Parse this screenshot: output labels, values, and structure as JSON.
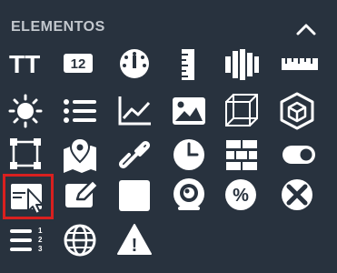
{
  "panel": {
    "title": "ELEMENTOS",
    "collapse_icon": "chevron-up-icon"
  },
  "colors": {
    "background": "#28323e",
    "icon": "#ffffff",
    "title": "#c3c8ce",
    "selection": "#d9201f"
  },
  "elements": [
    {
      "name": "text-size-icon",
      "glyph_text": "TT"
    },
    {
      "name": "number-icon",
      "glyph_text": "12"
    },
    {
      "name": "gauge-icon"
    },
    {
      "name": "vertical-ruler-icon"
    },
    {
      "name": "bar-columns-icon"
    },
    {
      "name": "horizontal-ruler-icon"
    },
    {
      "name": "sun-icon"
    },
    {
      "name": "list-icon"
    },
    {
      "name": "line-chart-icon"
    },
    {
      "name": "image-icon"
    },
    {
      "name": "cube-outline-icon"
    },
    {
      "name": "3d-box-icon"
    },
    {
      "name": "selection-frame-icon"
    },
    {
      "name": "map-pin-icon"
    },
    {
      "name": "link-icon"
    },
    {
      "name": "clock-icon"
    },
    {
      "name": "stack-icon"
    },
    {
      "name": "toggle-icon"
    },
    {
      "name": "window-cursor-icon",
      "selected": true
    },
    {
      "name": "pencil-box-icon"
    },
    {
      "name": "square-icon"
    },
    {
      "name": "webcam-icon"
    },
    {
      "name": "percent-icon",
      "glyph_text": "%"
    },
    {
      "name": "close-circle-icon"
    },
    {
      "name": "numbered-list-icon",
      "glyph_text": "123"
    },
    {
      "name": "globe-icon"
    },
    {
      "name": "warning-icon",
      "glyph_text": "!"
    }
  ]
}
